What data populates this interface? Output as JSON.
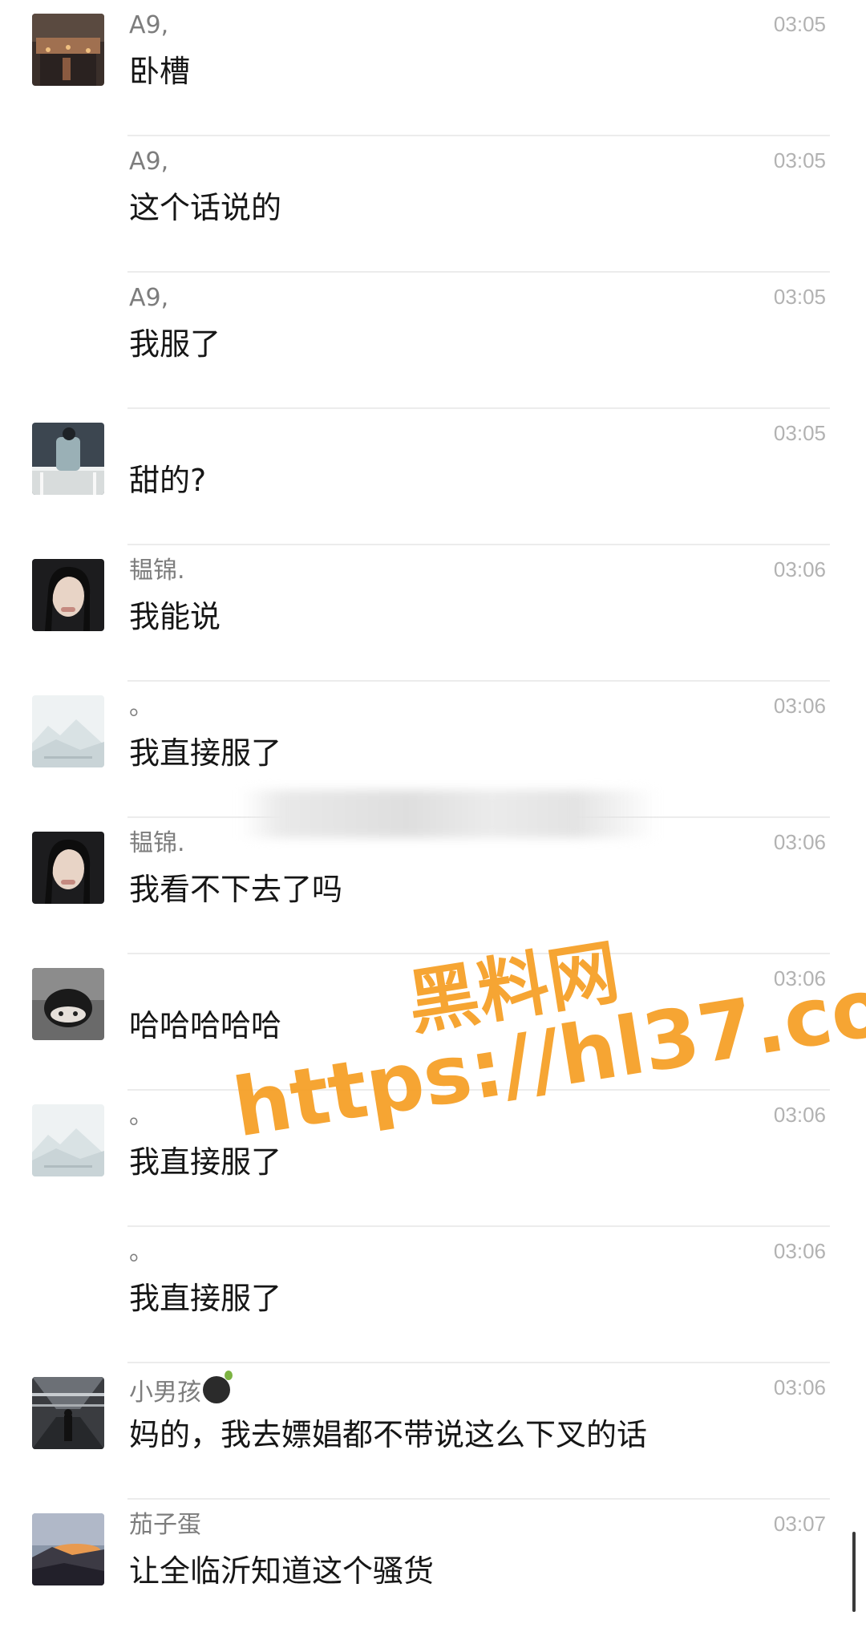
{
  "messages": [
    {
      "sender": "A9,",
      "text": "卧槽",
      "time": "03:05",
      "avatar": "city-night"
    },
    {
      "sender": "A9,",
      "text": "这个话说的",
      "time": "03:05",
      "avatar": ""
    },
    {
      "sender": "A9,",
      "text": "我服了",
      "time": "03:05",
      "avatar": ""
    },
    {
      "sender": "",
      "text": "甜的?",
      "time": "03:05",
      "avatar": "man-back"
    },
    {
      "sender": "韫锦.",
      "text": "我能说",
      "time": "03:06",
      "avatar": "girl-portrait"
    },
    {
      "sender": "。",
      "text": "我直接服了",
      "time": "03:06",
      "avatar": "misty-landscape"
    },
    {
      "sender": "韫锦.",
      "text": "我看不下去了吗",
      "time": "03:06",
      "avatar": "girl-portrait"
    },
    {
      "sender": "",
      "text": "哈哈哈哈哈",
      "time": "03:06",
      "avatar": "boy-hood"
    },
    {
      "sender": "。",
      "text": "我直接服了",
      "time": "03:06",
      "avatar": "misty-landscape"
    },
    {
      "sender": "。",
      "text": "我直接服了",
      "time": "03:06",
      "avatar": ""
    },
    {
      "sender": "小男孩",
      "text": "妈的，我去嫖娼都不带说这么下叉的话",
      "time": "03:06",
      "avatar": "corridor",
      "emoji": "bomb-icon"
    },
    {
      "sender": "茄子蛋",
      "text": "让全临沂知道这个骚货",
      "time": "03:07",
      "avatar": "sunset"
    }
  ],
  "watermark": {
    "title": "黑料网",
    "url": "https://hl37.co",
    "color": "#f6a028"
  },
  "colors": {
    "sender": "#7d7d7d",
    "text": "#161616",
    "time": "#b2b2b2",
    "divider": "#ececec"
  }
}
